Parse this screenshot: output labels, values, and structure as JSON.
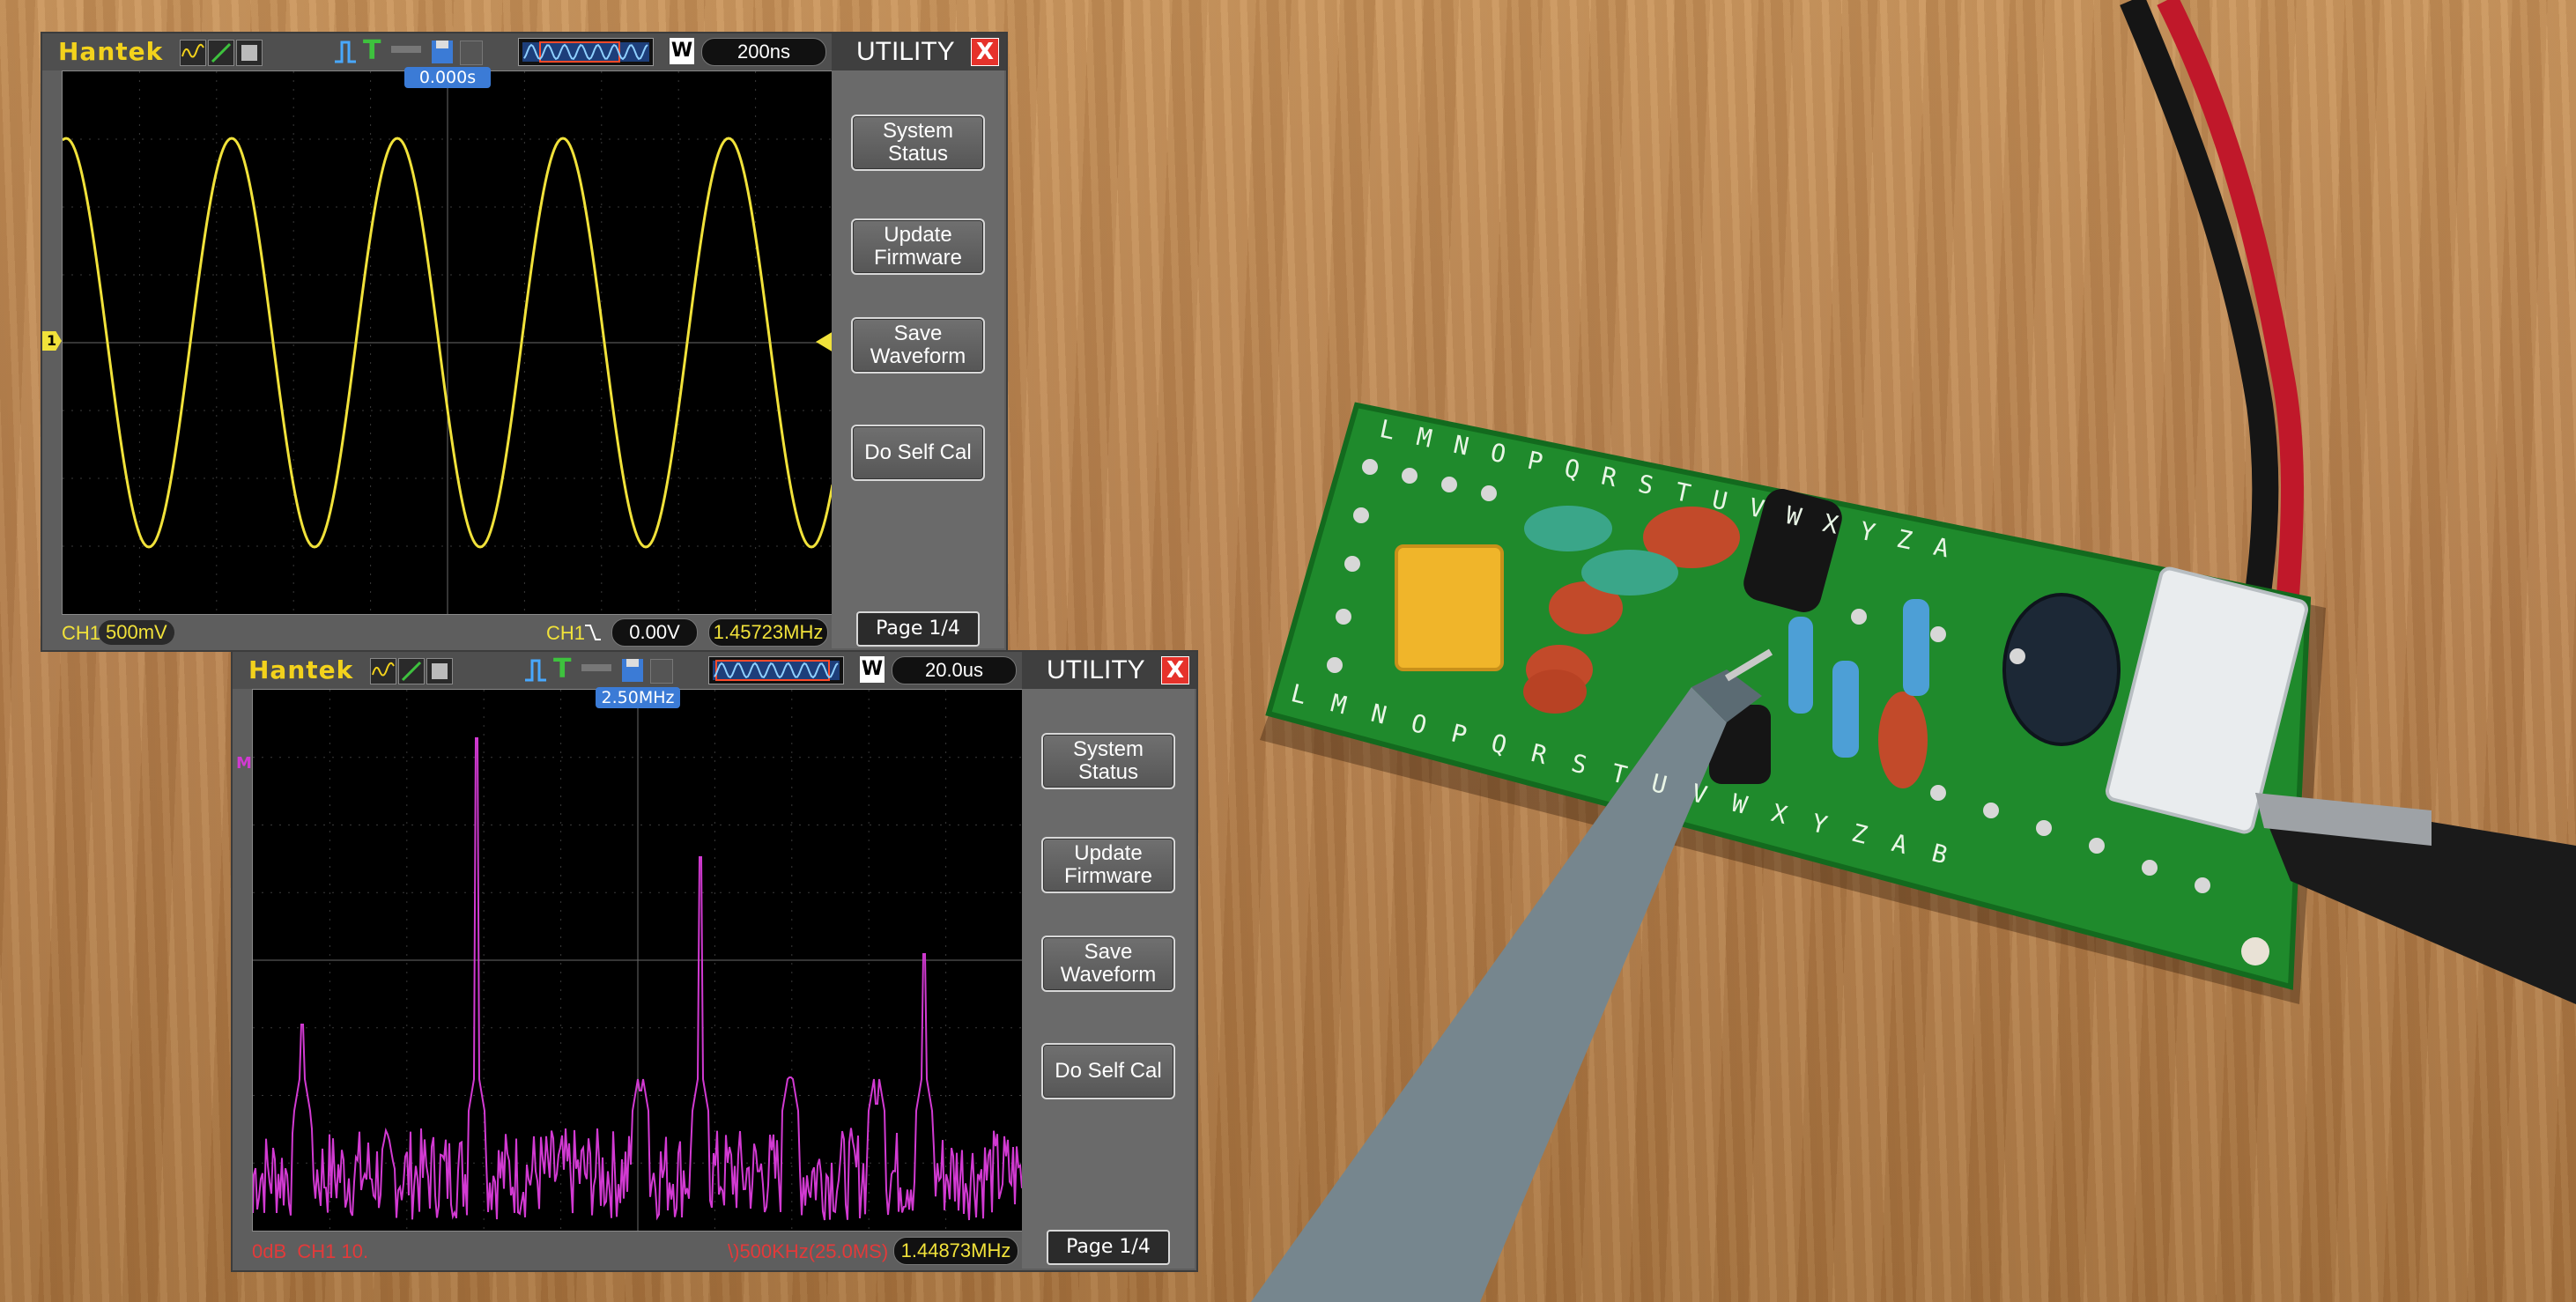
{
  "scope_top": {
    "brand": "Hantek",
    "timebase": "200ns",
    "w_label": "W",
    "menu_title": "UTILITY",
    "close_label": "X",
    "trigger_time": "0.000s",
    "channel_marker": "1",
    "buttons": [
      "System\nStatus",
      "Update\nFirmware",
      "Save\nWaveform",
      "Do Self Cal"
    ],
    "page_label": "Page 1/4",
    "ch_label": "CH1",
    "ch_scale": "500mV",
    "trig_ch": "CH1",
    "trig_level": "0.00V",
    "frequency": "1.45723MHz",
    "trace_color": "#f1e23a"
  },
  "scope_bottom": {
    "brand": "Hantek",
    "timebase": "20.0us",
    "w_label": "W",
    "menu_title": "UTILITY",
    "close_label": "X",
    "center_freq": "2.50MHz",
    "math_marker": "M",
    "buttons": [
      "System\nStatus",
      "Update\nFirmware",
      "Save\nWaveform",
      "Do Self Cal"
    ],
    "page_label": "Page 1/4",
    "fft_left": "0dB  CH1 10.",
    "fft_right": "\\)500KHz(25.0MS)",
    "frequency": "1.44873MHz",
    "trace_color": "#d23ad2"
  },
  "pcb": {
    "top_row": [
      "L",
      "M",
      "N",
      "O",
      "P",
      "Q",
      "R",
      "S",
      "T",
      "U",
      "V",
      "W",
      "X",
      "Y",
      "Z",
      "A"
    ],
    "bottom_row": [
      "L",
      "M",
      "N",
      "O",
      "P",
      "Q",
      "R",
      "S",
      "T",
      "U",
      "V",
      "W",
      "X",
      "Y",
      "Z",
      "A",
      "B"
    ]
  }
}
